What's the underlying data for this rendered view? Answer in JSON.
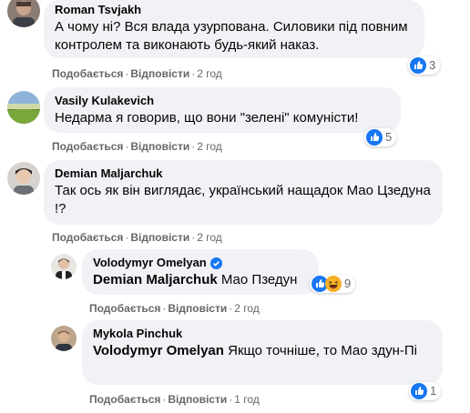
{
  "actions": {
    "like_label": "Подобається",
    "reply_label": "Відповісти",
    "separator": "·"
  },
  "colors": {
    "bubble": "#f0f2f5",
    "like_blue": "#1877f2",
    "meta_gray": "#65676b",
    "verified_blue": "#1877f2"
  },
  "comments": [
    {
      "author": "Roman Tsvjakh",
      "text": "А чому ні? Вся влада узурпована. Силовики під повним контролем та виконають будь-який наказ.",
      "time": "2 год",
      "reaction_count": "3",
      "reaction_icons": [
        "like-icon"
      ]
    },
    {
      "author": "Vasily Kulakevich",
      "text": "Недарма я говорив, що вони \"зелені\" комуністи!",
      "time": "2 год",
      "reaction_count": "5",
      "reaction_icons": [
        "like-icon"
      ]
    },
    {
      "author": "Demian Maljarchuk",
      "text": "Так ось як він виглядає, український нащадок Мао Цзедуна !?",
      "time": "2 год"
    }
  ],
  "replies": [
    {
      "author": "Volodymyr Omelyan",
      "verified": true,
      "mention": "Demian Maljarchuk",
      "text": "Мао Пзедун",
      "time": "2 год",
      "reaction_count": "9",
      "reaction_icons": [
        "like-icon",
        "haha-icon"
      ]
    },
    {
      "author": "Mykola Pinchuk",
      "mention": "Volodymyr Omelyan",
      "text": "Якщо точніше, то Мао здун-Пі",
      "time": "1 год",
      "reaction_count": "1",
      "reaction_icons": [
        "like-icon"
      ]
    }
  ]
}
